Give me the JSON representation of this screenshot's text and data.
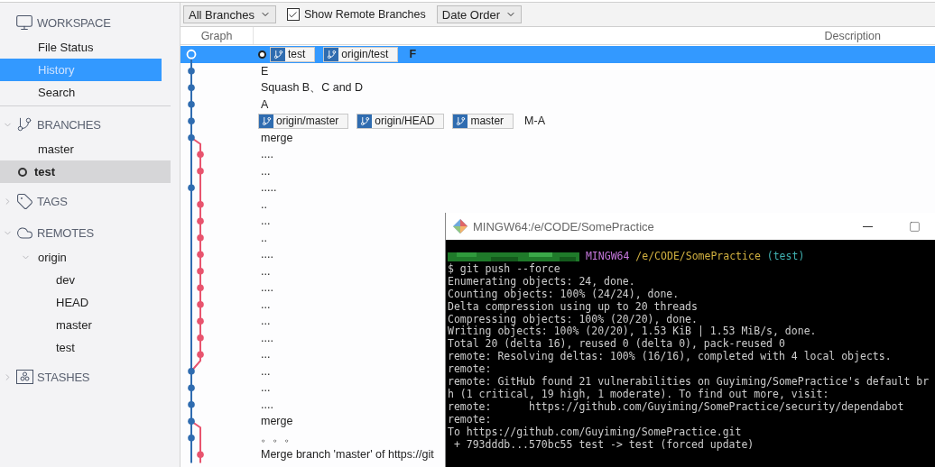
{
  "sidebar": {
    "sections": [
      {
        "kind": "workspace",
        "title": "WORKSPACE",
        "items": [
          {
            "label": "File Status",
            "selected": false
          },
          {
            "label": "History",
            "selected": true
          },
          {
            "label": "Search",
            "selected": false
          }
        ]
      },
      {
        "kind": "branches",
        "title": "BRANCHES",
        "expanded": true,
        "items": [
          {
            "label": "master",
            "current": false
          },
          {
            "label": "test",
            "current": true
          }
        ]
      },
      {
        "kind": "tags",
        "title": "TAGS",
        "expanded": false
      },
      {
        "kind": "remotes",
        "title": "REMOTES",
        "expanded": true,
        "remotes": [
          {
            "label": "origin",
            "expanded": true,
            "children": [
              {
                "label": "dev"
              },
              {
                "label": "HEAD"
              },
              {
                "label": "master"
              },
              {
                "label": "test"
              }
            ]
          }
        ]
      },
      {
        "kind": "stashes",
        "title": "STASHES",
        "expanded": false
      }
    ]
  },
  "toolbar": {
    "branch_filter": "All Branches",
    "show_remote": {
      "label": "Show Remote Branches",
      "checked": true
    },
    "order": "Date Order"
  },
  "table": {
    "columns": [
      "Graph",
      "Description"
    ],
    "rows": [
      {
        "message": "F",
        "refs": [
          "test",
          "origin/test"
        ],
        "head": true,
        "selected": true,
        "merge": false,
        "kind": "main"
      },
      {
        "message": "E",
        "selected": false,
        "merge": false,
        "kind": "main"
      },
      {
        "message": "Squash B、C and D",
        "selected": false,
        "merge": false,
        "kind": "main"
      },
      {
        "message": "A",
        "selected": false,
        "merge": false,
        "kind": "main"
      },
      {
        "message": "M-A",
        "refs": [
          "origin/master",
          "origin/HEAD",
          "master"
        ],
        "selected": false,
        "merge": false,
        "kind": "main"
      },
      {
        "message": "merge",
        "merge": true,
        "selected": false,
        "kind": "main"
      },
      {
        "message": "....",
        "selected": false,
        "merge": false,
        "kind": "side"
      },
      {
        "message": "...",
        "selected": false,
        "merge": false,
        "kind": "side"
      },
      {
        "message": ".....",
        "selected": false,
        "merge": false,
        "kind": "main"
      },
      {
        "message": "..",
        "selected": false,
        "merge": false,
        "kind": "side"
      },
      {
        "message": "...",
        "selected": false,
        "merge": false,
        "kind": "side"
      },
      {
        "message": "..",
        "selected": false,
        "merge": false,
        "kind": "side"
      },
      {
        "message": "....",
        "selected": false,
        "merge": false,
        "kind": "side"
      },
      {
        "message": "...",
        "selected": false,
        "merge": false,
        "kind": "side"
      },
      {
        "message": "....",
        "selected": false,
        "merge": false,
        "kind": "side"
      },
      {
        "message": "...",
        "selected": false,
        "merge": false,
        "kind": "side"
      },
      {
        "message": "...",
        "selected": false,
        "merge": false,
        "kind": "side"
      },
      {
        "message": "....",
        "selected": false,
        "merge": false,
        "kind": "side"
      },
      {
        "message": "...",
        "selected": false,
        "merge": false,
        "kind": "side"
      },
      {
        "message": "...",
        "selected": false,
        "merge": false,
        "kind": "main"
      },
      {
        "message": "...",
        "selected": false,
        "merge": false,
        "kind": "main"
      },
      {
        "message": "....",
        "selected": false,
        "merge": false,
        "kind": "main"
      },
      {
        "message": "merge",
        "merge": true,
        "selected": false,
        "kind": "main"
      },
      {
        "message": "。。。",
        "selected": false,
        "merge": false,
        "kind": "main"
      },
      {
        "message": "Merge branch 'master' of https://git",
        "selected": false,
        "merge": false,
        "kind": "side"
      }
    ]
  },
  "terminal": {
    "title": "MINGW64:/e/CODE/SomePractice",
    "prompt": {
      "system": "MINGW64",
      "path": "/e/CODE/SomePractice",
      "branch": "(test)"
    },
    "lines": [
      "$ git push --force",
      "Enumerating objects: 24, done.",
      "Counting objects: 100% (24/24), done.",
      "Delta compression using up to 20 threads",
      "Compressing objects: 100% (20/20), done.",
      "Writing objects: 100% (20/20), 1.53 KiB | 1.53 MiB/s, done.",
      "Total 20 (delta 16), reused 0 (delta 0), pack-reused 0",
      "remote: Resolving deltas: 100% (16/16), completed with 4 local objects.",
      "remote:",
      "remote: GitHub found 21 vulnerabilities on Guyiming/SomePractice's default br",
      "h (1 critical, 19 high, 1 moderate). To find out more, visit:",
      "remote:      https://github.com/Guyiming/SomePractice/security/dependabot",
      "remote:",
      "To https://github.com/Guyiming/SomePractice.git",
      " + 793dddb...570bc55 test -> test (forced update)"
    ]
  }
}
